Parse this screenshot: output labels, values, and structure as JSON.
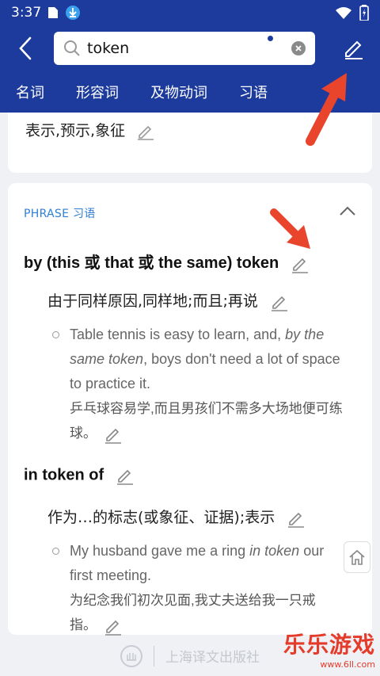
{
  "status_bar": {
    "time": "3:37"
  },
  "search": {
    "value": "token"
  },
  "tabs": [
    "名词",
    "形容词",
    "及物动词",
    "习语"
  ],
  "top_card": {
    "cut_text": "表示,预示,象征"
  },
  "phrase_section": {
    "header": "PHRASE 习语"
  },
  "entries": [
    {
      "title": "by (this 或 that 或 the same) token",
      "sense": "由于同样原因,同样地;而且;再说",
      "example_en_pre": "Table tennis is easy to learn, and, ",
      "example_en_em": "by the same token",
      "example_en_post": ", boys don't need a lot of space to practice it.",
      "example_zh": "乒乓球容易学,而且男孩们不需多大场地便可练球。"
    },
    {
      "title": "in token of",
      "sense": "作为…的标志(或象征、证据);表示",
      "example_en_pre": "My husband gave me a ring ",
      "example_en_em": "in token",
      "example_en_post": " our first meeting.",
      "example_zh": "为纪念我们初次见面,我丈夫送给我一只戒指。"
    }
  ],
  "footer": {
    "publisher": "上海译文出版社"
  },
  "watermark": {
    "main": "乐乐游戏",
    "url": "www.6ll.com"
  },
  "colors": {
    "header_bg": "#1d3b9c",
    "accent": "#2e7fd6",
    "arrow": "#e8452c"
  }
}
